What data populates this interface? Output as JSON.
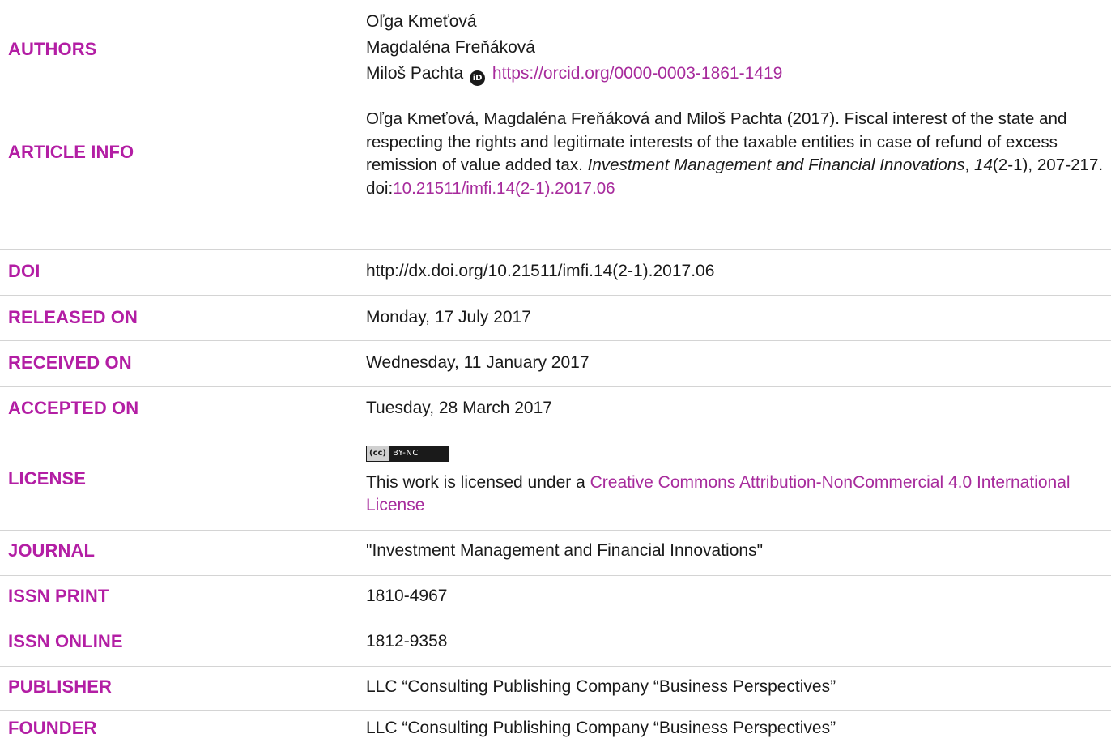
{
  "authors": {
    "label": "AUTHORS",
    "names": [
      "Oľga Kmeťová",
      "Magdaléna Freňáková",
      "Miloš Pachta"
    ],
    "orcid_icon_text": "iD",
    "orcid_url": "https://orcid.org/0000-0003-1861-1419"
  },
  "article_info": {
    "label": "ARTICLE INFO",
    "citation_authors": "Oľga Kmeťová, Magdaléna Freňáková and Miloš Pachta (2017). Fiscal interest of the state and respecting the rights and legitimate interests of the taxable entities in case of refund of excess remission of value added tax.",
    "journal_italic": "Investment Management and Financial Innovations",
    "sep1": ", ",
    "volume_italic": "14",
    "issue_pages": "(2-1), 207-217.",
    "doi_prefix": "doi:",
    "doi_link": "10.21511/imfi.14(2-1).2017.06"
  },
  "doi": {
    "label": "DOI",
    "value": "http://dx.doi.org/10.21511/imfi.14(2-1).2017.06"
  },
  "released_on": {
    "label": "RELEASED ON",
    "value": "Monday, 17 July 2017"
  },
  "received_on": {
    "label": "RECEIVED ON",
    "value": "Wednesday, 11 January 2017"
  },
  "accepted_on": {
    "label": "ACCEPTED ON",
    "value": "Tuesday, 28 March 2017"
  },
  "license": {
    "label": "LICENSE",
    "badge_left": "(cc)",
    "badge_right": "BY-NC",
    "text_prefix": "This work is licensed under a ",
    "link_text": "Creative Commons Attribution-NonCommercial 4.0 International License"
  },
  "journal": {
    "label": "JOURNAL",
    "value": "\"Investment Management and Financial Innovations\""
  },
  "issn_print": {
    "label": "ISSN PRINT",
    "value": "1810-4967"
  },
  "issn_online": {
    "label": "ISSN ONLINE",
    "value": "1812-9358"
  },
  "publisher": {
    "label": "PUBLISHER",
    "value": "LLC “Consulting Publishing Company “Business Perspectives”"
  },
  "founder": {
    "label": "FOUNDER",
    "value": "LLC “Consulting Publishing Company “Business Perspectives”"
  },
  "colors": {
    "label_accent": "#b31ea4",
    "link": "#a72b9c",
    "divider": "#d4d4d4",
    "text": "#1a1a1a"
  }
}
